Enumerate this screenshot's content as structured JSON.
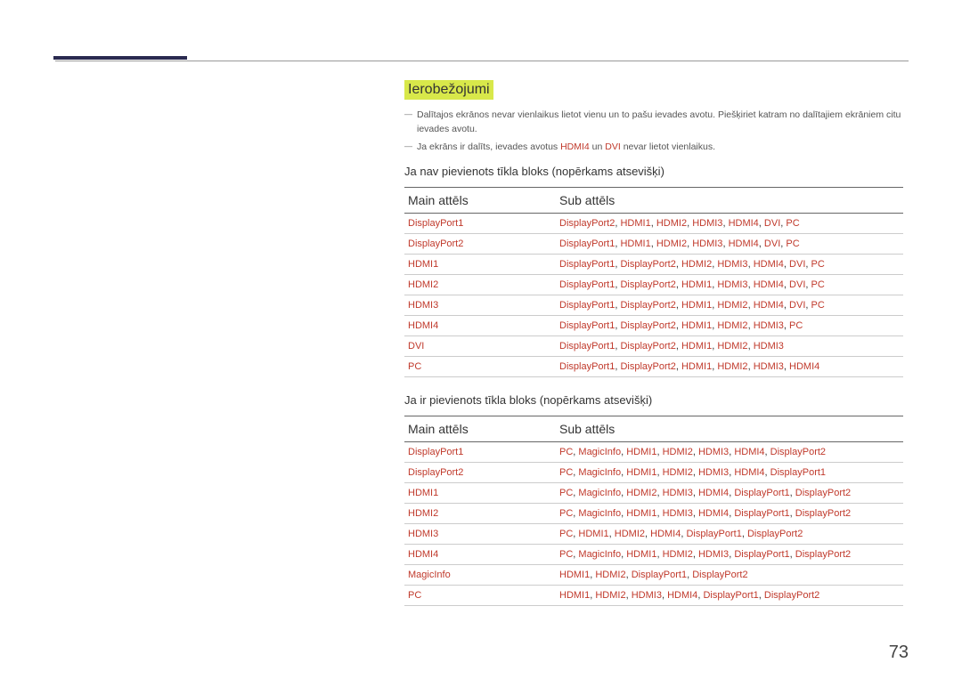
{
  "page_number": "73",
  "section_title": "Ierobežojumi",
  "notes": {
    "n1": "Dalītajos ekrānos nevar vienlaikus lietot vienu un to pašu ievades avotu. Piešķiriet katram no dalītajiem ekrāniem citu ievades avotu.",
    "n2_pre": "Ja ekrāns ir dalīts, ievades avotus ",
    "n2_r1": "HDMI4",
    "n2_mid": " un ",
    "n2_r2": "DVI",
    "n2_post": " nevar lietot vienlaikus."
  },
  "subheads": {
    "s1": "Ja nav pievienots tīkla bloks (nopērkams atsevišķi)",
    "s2": "Ja ir pievienots tīkla bloks (nopērkams atsevišķi)"
  },
  "headers": {
    "main": "Main attēls",
    "sub": "Sub attēls"
  },
  "table1": [
    {
      "main": "DisplayPort1",
      "sub": [
        "DisplayPort2",
        "HDMI1",
        "HDMI2",
        "HDMI3",
        "HDMI4",
        "DVI",
        "PC"
      ]
    },
    {
      "main": "DisplayPort2",
      "sub": [
        "DisplayPort1",
        "HDMI1",
        "HDMI2",
        "HDMI3",
        "HDMI4",
        "DVI",
        "PC"
      ]
    },
    {
      "main": "HDMI1",
      "sub": [
        "DisplayPort1",
        "DisplayPort2",
        "HDMI2",
        "HDMI3",
        "HDMI4",
        "DVI",
        "PC"
      ]
    },
    {
      "main": "HDMI2",
      "sub": [
        "DisplayPort1",
        "DisplayPort2",
        "HDMI1",
        "HDMI3",
        "HDMI4",
        "DVI",
        "PC"
      ]
    },
    {
      "main": "HDMI3",
      "sub": [
        "DisplayPort1",
        "DisplayPort2",
        "HDMI1",
        "HDMI2",
        "HDMI4",
        "DVI",
        "PC"
      ]
    },
    {
      "main": "HDMI4",
      "sub": [
        "DisplayPort1",
        "DisplayPort2",
        "HDMI1",
        "HDMI2",
        "HDMI3",
        "PC"
      ]
    },
    {
      "main": "DVI",
      "sub": [
        "DisplayPort1",
        "DisplayPort2",
        "HDMI1",
        "HDMI2",
        "HDMI3"
      ]
    },
    {
      "main": "PC",
      "sub": [
        "DisplayPort1",
        "DisplayPort2",
        "HDMI1",
        "HDMI2",
        "HDMI3",
        "HDMI4"
      ]
    }
  ],
  "table2": [
    {
      "main": "DisplayPort1",
      "sub": [
        "PC",
        "MagicInfo",
        "HDMI1",
        "HDMI2",
        "HDMI3",
        "HDMI4",
        "DisplayPort2"
      ]
    },
    {
      "main": "DisplayPort2",
      "sub": [
        "PC",
        "MagicInfo",
        "HDMI1",
        "HDMI2",
        "HDMI3",
        "HDMI4",
        "DisplayPort1"
      ]
    },
    {
      "main": "HDMI1",
      "sub": [
        "PC",
        "MagicInfo",
        "HDMI2",
        "HDMI3",
        "HDMI4",
        "DisplayPort1",
        "DisplayPort2"
      ]
    },
    {
      "main": "HDMI2",
      "sub": [
        "PC",
        "MagicInfo",
        "HDMI1",
        "HDMI3",
        "HDMI4",
        "DisplayPort1",
        "DisplayPort2"
      ]
    },
    {
      "main": "HDMI3",
      "sub": [
        "PC",
        "HDMI1",
        "HDMI2",
        "HDMI4",
        "DisplayPort1",
        "DisplayPort2"
      ]
    },
    {
      "main": "HDMI4",
      "sub": [
        "PC",
        "MagicInfo",
        "HDMI1",
        "HDMI2",
        "HDMI3",
        "DisplayPort1",
        "DisplayPort2"
      ]
    },
    {
      "main": "MagicInfo",
      "sub": [
        "HDMI1",
        "HDMI2",
        "DisplayPort1",
        "DisplayPort2"
      ]
    },
    {
      "main": "PC",
      "sub": [
        "HDMI1",
        "HDMI2",
        "HDMI3",
        "HDMI4",
        "DisplayPort1",
        "DisplayPort2"
      ]
    }
  ]
}
